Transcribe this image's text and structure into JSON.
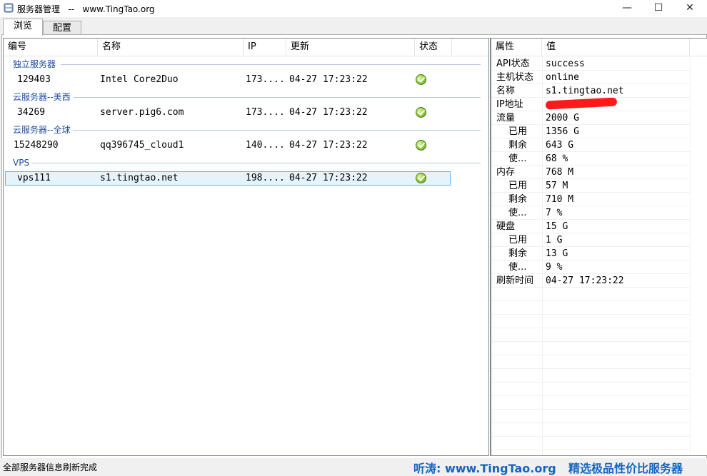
{
  "window": {
    "title": "服务器管理   --   www.TingTao.org",
    "minimize": "—",
    "maximize": "☐",
    "close": "✕"
  },
  "tabs": [
    {
      "label": "浏览",
      "active": true
    },
    {
      "label": "配置",
      "active": false
    }
  ],
  "server_list": {
    "columns": [
      "编号",
      "名称",
      "IP",
      "更新",
      "状态"
    ],
    "groups": [
      {
        "name": "独立服务器",
        "rows": [
          {
            "id": "129403",
            "name": "Intel Core2Duo",
            "ip": "173....",
            "updated": "04-27 17:23:22",
            "status": "ok-icon"
          }
        ]
      },
      {
        "name": "云服务器--美西",
        "rows": [
          {
            "id": "34269",
            "name": "server.pig6.com",
            "ip": "173....",
            "updated": "04-27 17:23:22",
            "status": "ok-icon"
          }
        ]
      },
      {
        "name": "云服务器--全球",
        "rows": [
          {
            "id": "15248290",
            "name": "qq396745_cloud1",
            "ip": "140....",
            "updated": "04-27 17:23:22",
            "status": "ok-icon"
          }
        ]
      },
      {
        "name": "VPS",
        "rows": [
          {
            "id": "vps111",
            "name": "s1.tingtao.net",
            "ip": "198....",
            "updated": "04-27 17:23:22",
            "status": "ok-icon",
            "selected": true
          }
        ]
      }
    ]
  },
  "properties": {
    "columns": [
      "属性",
      "值"
    ],
    "rows": [
      {
        "name": "API状态",
        "value": "success"
      },
      {
        "name": "主机状态",
        "value": "online"
      },
      {
        "name": "名称",
        "value": "s1.tingtao.net"
      },
      {
        "name": "IP地址",
        "value": "",
        "redacted": true
      },
      {
        "name": "流量",
        "value": "2000 G"
      },
      {
        "name": "已用",
        "value": "1356 G",
        "indent": true
      },
      {
        "name": "剩余",
        "value": "643 G",
        "indent": true
      },
      {
        "name": "使...",
        "value": "68 %",
        "indent": true
      },
      {
        "name": "内存",
        "value": "768 M"
      },
      {
        "name": "已用",
        "value": "57 M",
        "indent": true
      },
      {
        "name": "剩余",
        "value": "710 M",
        "indent": true
      },
      {
        "name": "使...",
        "value": "7 %",
        "indent": true
      },
      {
        "name": "硬盘",
        "value": "15 G"
      },
      {
        "name": "已用",
        "value": "1 G",
        "indent": true
      },
      {
        "name": "剩余",
        "value": "13 G",
        "indent": true
      },
      {
        "name": "使...",
        "value": "9 %",
        "indent": true
      },
      {
        "name": "刷新时间",
        "value": "04-27 17:23:22"
      }
    ]
  },
  "statusbar": {
    "message": "全部服务器信息刷新完成",
    "site": "听涛: www.TingTao.org",
    "slogan": "精选极品性价比服务器"
  },
  "colors": {
    "group_header": "#1e4b9e",
    "promo": "#1565c0",
    "selection_border": "#70b2e5",
    "selection_fill": "#e5f3fb",
    "redaction": "#ff1a1a"
  }
}
